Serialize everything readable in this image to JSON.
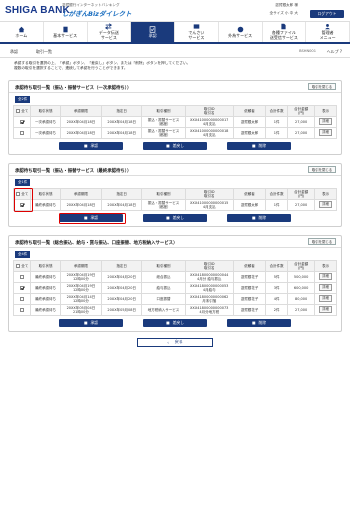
{
  "header": {
    "bank_name": "SHIGA BANK",
    "service_line1": "滋賀銀行インターネットバンキング",
    "service_line2": "しがぎんBizダイレクト",
    "user_info": "滋賀銀太郎 様",
    "user_info2": "全サイズ 小 中 大",
    "logout_label": "ログアウト"
  },
  "nav": {
    "items": [
      {
        "label": "ホーム",
        "icon": "home-icon"
      },
      {
        "label": "基本サービス",
        "icon": "document-icon"
      },
      {
        "label": "データ伝送\nサービス",
        "icon": "transfer-icon"
      },
      {
        "label": "承認",
        "icon": "approve-icon"
      },
      {
        "label": "でんさい\nサービス",
        "icon": "densai-icon"
      },
      {
        "label": "外為サービス",
        "icon": "globe-icon"
      },
      {
        "label": "各種ファイル\n送受信サービス",
        "icon": "file-icon"
      },
      {
        "label": "管理者\nメニュー",
        "icon": "admin-icon"
      }
    ]
  },
  "breadcrumb": {
    "first": "承認",
    "second": "取引一覧",
    "screen_id": "BSHN001",
    "help_label": "ヘルプ"
  },
  "intro_text": "承認する取引を選択の上、「承認」ボタン、「差戻し」ボタン、または「削除」ボタンを押してください。\n複数の取引を選択することで、連続して承認を行うことができます。",
  "table_headers": [
    "全て",
    "取引状態",
    "承認期限",
    "指定日",
    "取引種別",
    "取引ID\n取引名",
    "依頼者",
    "合計件数",
    "合計金額\n(円)",
    "表示"
  ],
  "sections": [
    {
      "title": "承認待ち取引一覧（振込・振替サービス（一次承認待ち））",
      "collapse_label": "取引を閉じる",
      "count": "全2件",
      "rows": [
        {
          "checked": true,
          "status": "一次承認待ち",
          "deadline": "20XX年04月18日",
          "date": "20XX年04月18日",
          "type": "振込・振替サービス\n（都度）",
          "id": "XXX41000000000017\n4月支払",
          "requester": "滋賀銀太郎",
          "count": "1件",
          "amount": "27,000",
          "show": "詳細"
        },
        {
          "checked": false,
          "status": "一次承認待ち",
          "deadline": "20XX年04月18日",
          "date": "20XX年04月18日",
          "type": "振込・振替サービス\n（都度）",
          "id": "XXX41000000000018\n4月支払",
          "requester": "滋賀銀太郎",
          "count": "1件",
          "amount": "27,000",
          "show": "詳細"
        }
      ],
      "buttons": [
        "承認",
        "差戻し",
        "削除"
      ]
    },
    {
      "title": "承認待ち取引一覧（振込・振替サービス（最終承認待ち））",
      "collapse_label": "取引を閉じる",
      "count": "全1件",
      "rows": [
        {
          "checked": true,
          "status": "最終承認待ち",
          "deadline": "20XX年04月18日",
          "date": "20XX年04月18日",
          "type": "振込・振替サービス\n（都度）",
          "id": "XXX41000000000015\n4月支払",
          "requester": "滋賀銀太郎",
          "count": "1件",
          "amount": "27,000",
          "show": "詳細"
        }
      ],
      "buttons": [
        "承認",
        "差戻し",
        "削除"
      ]
    },
    {
      "title": "承認待ち取引一覧（総合振込、給与・賞与振込、口座振替、地方税納入サービス）",
      "collapse_label": "取引を閉じる",
      "count": "全4件",
      "rows": [
        {
          "checked": false,
          "status": "最終承認待ち",
          "deadline": "20XX年04月19日\n12時00分",
          "date": "20XX年04月20日",
          "type": "総合振込",
          "id": "XXX41800000000044\n4月分 給与振込",
          "requester": "滋賀銀花子",
          "count": "5件",
          "amount": "500,000",
          "show": "詳細"
        },
        {
          "checked": true,
          "status": "最終承認待ち",
          "deadline": "20XX年04月19日\n12時00分",
          "date": "20XX年04月20日",
          "type": "給与振込",
          "id": "XXX41800000000053\n4月給与",
          "requester": "滋賀銀花子",
          "count": "3件",
          "amount": "600,000",
          "show": "詳細"
        },
        {
          "checked": false,
          "status": "最終承認待ち",
          "deadline": "20XX年04月14日\n12時00分",
          "date": "20XX年04月20日",
          "type": "口座振替",
          "id": "XXX41800000000062\n月末引落",
          "requester": "滋賀銀花子",
          "count": "4件",
          "amount": "80,000",
          "show": "詳細"
        },
        {
          "checked": false,
          "status": "最終承認待ち",
          "deadline": "20XX年05月04日\n21時00分",
          "date": "20XX年05月08日",
          "type": "地方税納入サービス",
          "id": "XXX41800000000073\n4月分地方税",
          "requester": "滋賀銀花子",
          "count": "2件",
          "amount": "27,000",
          "show": "詳細"
        }
      ],
      "buttons": [
        "承認",
        "差戻し",
        "削除"
      ]
    }
  ],
  "back_label": "戻る",
  "colors": {
    "primary": "#1a3a7c",
    "highlight": "#dd0000"
  }
}
